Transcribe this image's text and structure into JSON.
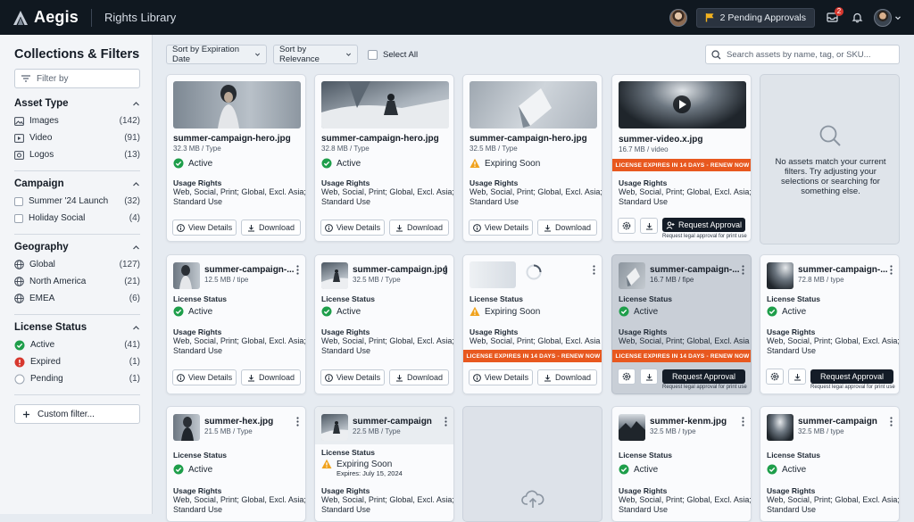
{
  "app": {
    "name": "Aegis",
    "page_title": "Rights Library",
    "pending_label": "2 Pending Approvals",
    "notification_count": "2"
  },
  "sidebar": {
    "title": "Collections & Filters",
    "filter_placeholder": "Filter by",
    "sections": [
      {
        "title": "Asset Type",
        "items": [
          {
            "label": "Images",
            "count": "(142)"
          },
          {
            "label": "Video",
            "count": "(91)"
          },
          {
            "label": "Logos",
            "count": "(13)"
          }
        ]
      },
      {
        "title": "Campaign",
        "items": [
          {
            "label": "Summer '24 Launch",
            "count": "(32)"
          },
          {
            "label": "Holiday Social",
            "count": "(4)"
          }
        ]
      },
      {
        "title": "Geography",
        "items": [
          {
            "label": "Global",
            "count": "(127)"
          },
          {
            "label": "North America",
            "count": "(21)"
          },
          {
            "label": "EMEA",
            "count": "(6)"
          }
        ]
      },
      {
        "title": "License Status",
        "items": [
          {
            "label": "Active",
            "count": "(41)"
          },
          {
            "label": "Expired",
            "count": "(1)"
          },
          {
            "label": "Pending",
            "count": "(1)"
          }
        ]
      }
    ],
    "custom_filter": "Custom filter..."
  },
  "toolbar": {
    "sort_date": "Sort by Expiration Date",
    "sort_relevance": "Sort by Relevance",
    "select_all": "Select All",
    "search_placeholder": "Search assets by name, tag, or SKU..."
  },
  "labels": {
    "usage_rights": "Usage Rights",
    "license_status": "License Status",
    "view_details": "View Details",
    "download": "Download",
    "request_approval": "Request Approval",
    "request_note": "Request legal approval for print use",
    "banner": "LICENSE EXPIRES IN 14 DAYS - RENEW NOW",
    "empty": "No assets match your current filters. Try adjusting your selections or searching for something else."
  },
  "cards": [
    {
      "name": "summer-campaign-hero.jpg",
      "meta": "32.3 MB / Type",
      "status": "Active",
      "rights": "Web, Social, Print; Global, Excl. Asia; Standard Use"
    },
    {
      "name": "summer-campaign-hero.jpg",
      "meta": "32.8 MB / Type",
      "status": "Active",
      "rights": "Web, Social, Print; Global, Excl. Asia; Standard Use"
    },
    {
      "name": "summer-campaign-hero.jpg",
      "meta": "32.5 MB / Type",
      "status": "Expiring Soon",
      "rights": "Web, Social, Print; Global, Excl. Asia; Standard Use"
    },
    {
      "name": "summer-video.x.jpg",
      "meta": "16.7 MB / video",
      "rights": "Web, Social, Print; Global, Excl. Asia; Standard Use"
    },
    {
      "name": "summer-campaign-...",
      "meta": "12.5 MB / tipe",
      "status": "Active",
      "rights": "Web, Social, Print; Global, Excl. Asia; Standard Use"
    },
    {
      "name": "summer-campaign.jpg",
      "meta": "32.5 MB / Type",
      "status": "Active",
      "rights": "Web, Social, Print; Global, Excl. Asia; Standard Use"
    },
    {
      "status": "Expiring Soon",
      "rights": "Web, Social, Print; Global, Excl. Asia"
    },
    {
      "name": "summer-campaign-...",
      "meta": "16.7 MB / fipe",
      "status": "Active",
      "rights": "Web, Social, Print; Global, Excl. Asia"
    },
    {
      "name": "summer-campaign-...",
      "meta": "72.8 MB / type",
      "status": "Active",
      "rights": "Web, Social, Print; Global, Excl. Asia; Standard Use"
    },
    {
      "name": "summer-hex.jpg",
      "meta": "21.5 MB / Type",
      "status": "Active",
      "rights": "Web, Social, Print; Global, Excl. Asia; Standard Use"
    },
    {
      "name": "summer-campaign",
      "meta": "22.5 MB / Type",
      "status": "Expiring Soon",
      "expires": "Expires: July 15, 2024",
      "rights": "Web, Social, Print; Global, Excl. Asia; Standard Use"
    },
    {
      "name": "summer-kenm.jpg",
      "meta": "32.5 MB / type",
      "status": "Active",
      "rights": "Web, Social, Print; Global, Excl. Asia; Standard Use"
    },
    {
      "name": "summer-campaign",
      "meta": "32.5 MB / type",
      "status": "Active",
      "rights": "Web, Social, Print; Global, Excl. Asia; Standard Use"
    }
  ]
}
